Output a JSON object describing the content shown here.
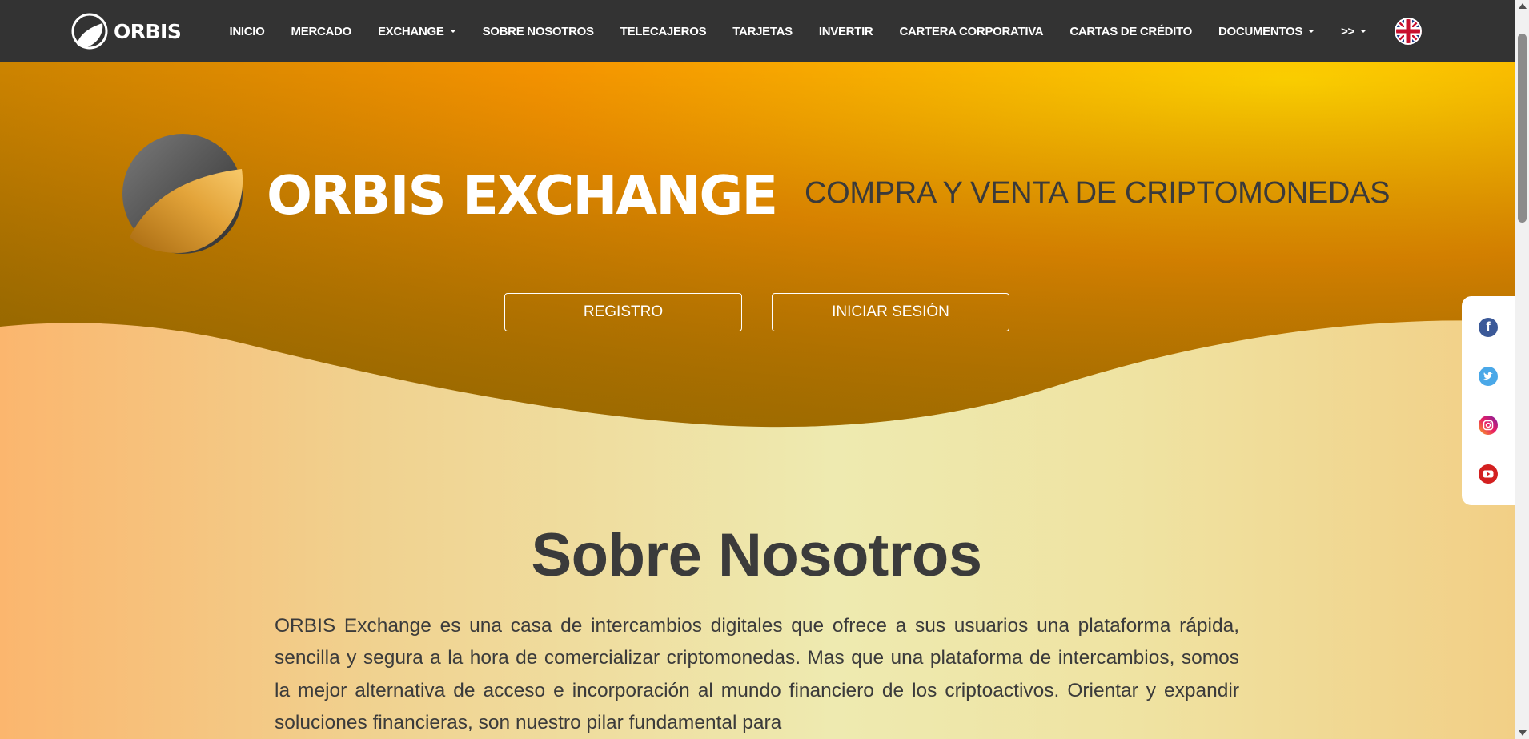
{
  "navbar": {
    "brand": "ORBIS",
    "items": [
      {
        "label": "INICIO",
        "dropdown": false
      },
      {
        "label": "MERCADO",
        "dropdown": false
      },
      {
        "label": "EXCHANGE",
        "dropdown": true
      },
      {
        "label": "SOBRE NOSOTROS",
        "dropdown": false
      },
      {
        "label": "TELECAJEROS",
        "dropdown": false
      },
      {
        "label": "TARJETAS",
        "dropdown": false
      },
      {
        "label": "INVERTIR",
        "dropdown": false
      },
      {
        "label": "CARTERA CORPORATIVA",
        "dropdown": false
      },
      {
        "label": "CARTAS DE CRÉDITO",
        "dropdown": false
      },
      {
        "label": "DOCUMENTOS",
        "dropdown": true
      },
      {
        "label": ">>",
        "dropdown": true
      }
    ],
    "language_icon": "uk-flag-icon"
  },
  "hero": {
    "title": "ORBIS EXCHANGE",
    "subtitle": "COMPRA Y VENTA DE CRIPTOMONEDAS",
    "register_label": "REGISTRO",
    "login_label": "INICIAR SESIÓN"
  },
  "social": [
    "facebook-icon",
    "twitter-icon",
    "instagram-icon",
    "youtube-icon"
  ],
  "about": {
    "title": "Sobre Nosotros",
    "text": "ORBIS Exchange es una casa de intercambios digitales que ofrece a sus usuarios una plataforma rápida, sencilla y segura a la hora de comercializar criptomonedas.  Mas que una plataforma de intercambios, somos la mejor alternativa de acceso e incorporación al mundo financiero de los criptoactivos.  Orientar y expandir soluciones financieras, son nuestro pilar fundamental para"
  },
  "colors": {
    "navbar": "#333333",
    "hero_orange": "#f59300",
    "hero_dark": "#b07a00",
    "text_dark": "#3b3b3b"
  }
}
